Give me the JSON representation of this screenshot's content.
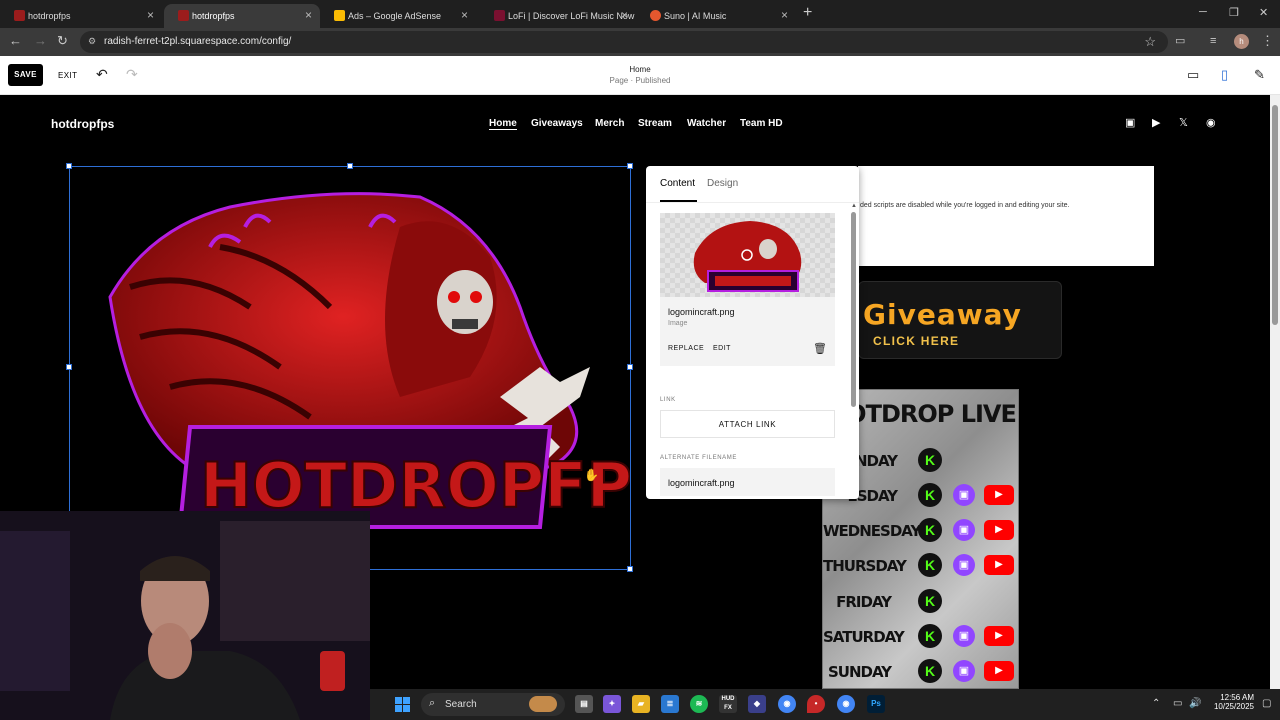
{
  "browser": {
    "tabs": [
      {
        "title": "hotdropfps",
        "active": false,
        "favicon_color": "#9b1c1c"
      },
      {
        "title": "hotdropfps",
        "active": true,
        "favicon_color": "#9b1c1c"
      },
      {
        "title": "Ads – Google AdSense",
        "active": false,
        "favicon_color": "#fbbc04"
      },
      {
        "title": "LoFi | Discover LoFi Music Now",
        "active": false,
        "favicon_color": "#7a1030"
      },
      {
        "title": "Suno | AI Music",
        "active": false,
        "favicon_color": "#e4572e"
      }
    ],
    "url": "radish-ferret-t2pl.squarespace.com/config/",
    "profile_initial": "h"
  },
  "editor": {
    "save_label": "SAVE",
    "exit_label": "EXIT",
    "page_title": "Home",
    "page_status": "Page · Published"
  },
  "site": {
    "logo": "hotdropfps",
    "nav": [
      "Home",
      "Giveaways",
      "Merch",
      "Stream",
      "Watcher",
      "Team HD"
    ],
    "active_nav": "Home",
    "social_icons": [
      "twitch-icon",
      "youtube-icon",
      "x-icon",
      "discord-icon"
    ],
    "notice_text": "ded scripts are disabled while you're logged in and editing your site.",
    "giveaway_title": "Giveaway",
    "giveaway_cta": "CLICK HERE",
    "hero_logo_text": "HOTDROPFPS",
    "schedule": {
      "title": "HOTDROP LIVE",
      "days": [
        {
          "day": "MONDAY",
          "label": "UNDAY",
          "kick": true,
          "twitch": false,
          "youtube": false
        },
        {
          "day": "TUESDAY",
          "label": "ESDAY",
          "kick": true,
          "twitch": true,
          "youtube": true
        },
        {
          "day": "WEDNESDAY",
          "label": "WEDNESDAY",
          "kick": true,
          "twitch": true,
          "youtube": true
        },
        {
          "day": "THURSDAY",
          "label": "THURSDAY",
          "kick": true,
          "twitch": true,
          "youtube": true
        },
        {
          "day": "FRIDAY",
          "label": "FRIDAY",
          "kick": true,
          "twitch": false,
          "youtube": false
        },
        {
          "day": "SATURDAY",
          "label": "SATURDAY",
          "kick": true,
          "twitch": true,
          "youtube": true
        },
        {
          "day": "SUNDAY",
          "label": "SUNDAY",
          "kick": true,
          "twitch": true,
          "youtube": true
        }
      ]
    }
  },
  "panel": {
    "tabs": [
      "Content",
      "Design"
    ],
    "active_tab": "Content",
    "filename": "logomincraft.png",
    "type": "Image",
    "replace_label": "REPLACE",
    "edit_label": "EDIT",
    "link_label": "LINK",
    "attach_link_label": "ATTACH LINK",
    "alt_filename_label": "ALTERNATE FILENAME",
    "alt_filename_value": "logomincraft.png"
  },
  "taskbar": {
    "search_label": "Search",
    "time": "12:56 AM",
    "date": "10/25/2025",
    "apps": [
      "paint-icon",
      "files-icon",
      "copilot-icon",
      "explorer-icon",
      "notepad-icon",
      "spotify-icon",
      "hud-fx-icon",
      "vpn-icon",
      "chrome-icon",
      "maps-icon",
      "chrome-profile-icon",
      "photoshop-icon"
    ]
  },
  "colors": {
    "selection_blue": "#2e6fd6",
    "hero_red": "#c41818",
    "hero_purple": "#b51fe0",
    "kick_green": "#53fc18",
    "twitch_purple": "#9146ff",
    "youtube_red": "#ff0000"
  }
}
